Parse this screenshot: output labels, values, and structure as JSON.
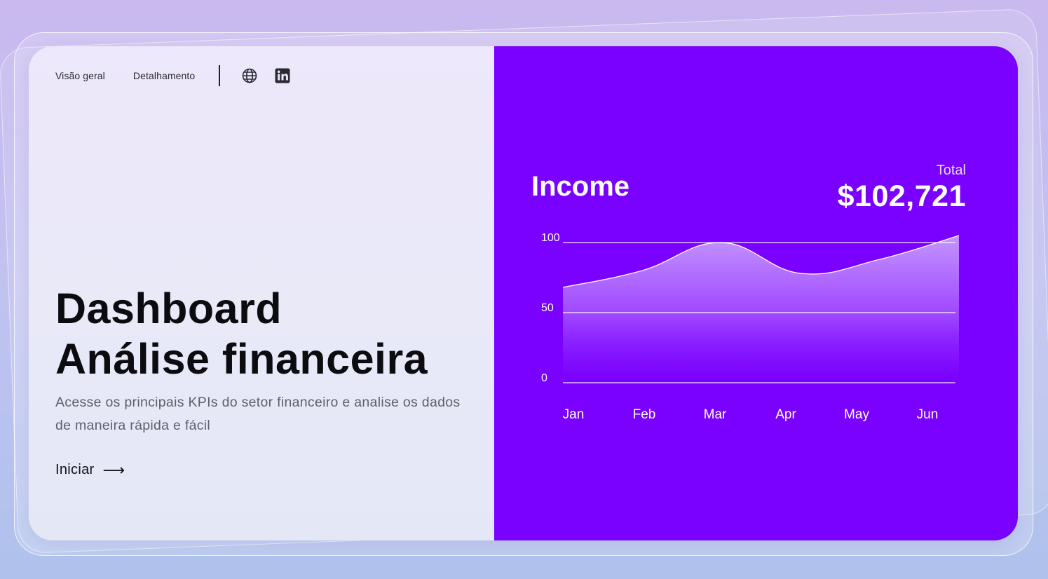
{
  "nav": {
    "items": [
      "Visão geral",
      "Detalhamento"
    ],
    "icons": [
      "globe-icon",
      "linkedin-icon"
    ]
  },
  "hero": {
    "title_line1": "Dashboard",
    "title_line2": "Análise financeira",
    "description": "Acesse os principais KPIs do setor financeiro e analise os dados de maneira rápida e fácil",
    "cta_label": "Iniciar",
    "cta_arrow": "⟶"
  },
  "income": {
    "title": "Income",
    "total_label": "Total",
    "total_value": "$102,721"
  },
  "colors": {
    "accent": "#7a00ff",
    "background_top": "#c9b9ef",
    "background_bottom": "#afc2ec"
  },
  "chart_data": {
    "type": "area",
    "title": "Income",
    "categories": [
      "Jan",
      "Feb",
      "Mar",
      "Apr",
      "May",
      "Jun"
    ],
    "x": [
      0,
      1,
      2,
      3,
      4,
      5
    ],
    "series": [
      {
        "values": [
          68,
          80,
          100,
          78,
          88,
          105
        ]
      }
    ],
    "ylim": [
      0,
      100
    ],
    "yticks": [
      0,
      50,
      100
    ],
    "grid": true,
    "xlabel": "",
    "ylabel": ""
  }
}
